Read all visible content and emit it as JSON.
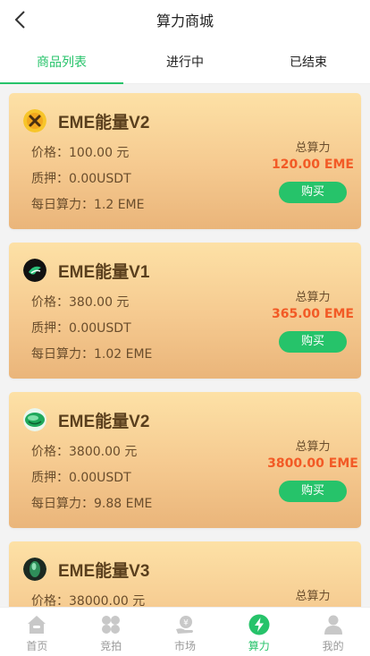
{
  "header": {
    "title": "算力商城"
  },
  "tabs": [
    {
      "label": "商品列表",
      "active": true
    },
    {
      "label": "进行中",
      "active": false
    },
    {
      "label": "已结束",
      "active": false
    }
  ],
  "products": [
    {
      "name": "EME能量V2",
      "icon": "yellow-coin-icon",
      "price": "价格：100.00 元",
      "pledge": "质押：0.00USDT",
      "daily": "每日算力：1.2 EME",
      "total_label": "总算力",
      "total_value": "120.00 EME",
      "buy_label": "购买"
    },
    {
      "name": "EME能量V1",
      "icon": "black-green-coin-icon",
      "price": "价格：380.00 元",
      "pledge": "质押：0.00USDT",
      "daily": "每日算力：1.02 EME",
      "total_label": "总算力",
      "total_value": "365.00 EME",
      "buy_label": "购买"
    },
    {
      "name": "EME能量V2",
      "icon": "green-coin-icon",
      "price": "价格：3800.00 元",
      "pledge": "质押：0.00USDT",
      "daily": "每日算力：9.88 EME",
      "total_label": "总算力",
      "total_value": "3800.00 EME",
      "buy_label": "购买"
    },
    {
      "name": "EME能量V3",
      "icon": "dark-green-gem-icon",
      "price": "价格：38000.00 元",
      "pledge": "",
      "daily": "",
      "total_label": "总算力",
      "total_value": "",
      "buy_label": ""
    }
  ],
  "bottom_nav": [
    {
      "label": "首页",
      "icon": "home-icon",
      "active": false
    },
    {
      "label": "竞拍",
      "icon": "grid-icon",
      "active": false
    },
    {
      "label": "市场",
      "icon": "market-hand-icon",
      "active": false
    },
    {
      "label": "算力",
      "icon": "lightning-icon",
      "active": true
    },
    {
      "label": "我的",
      "icon": "user-icon",
      "active": false
    }
  ],
  "colors": {
    "accent": "#26c36a",
    "price_red": "#f25a26",
    "card_top": "#fde1a6",
    "card_bottom": "#eab57a"
  }
}
